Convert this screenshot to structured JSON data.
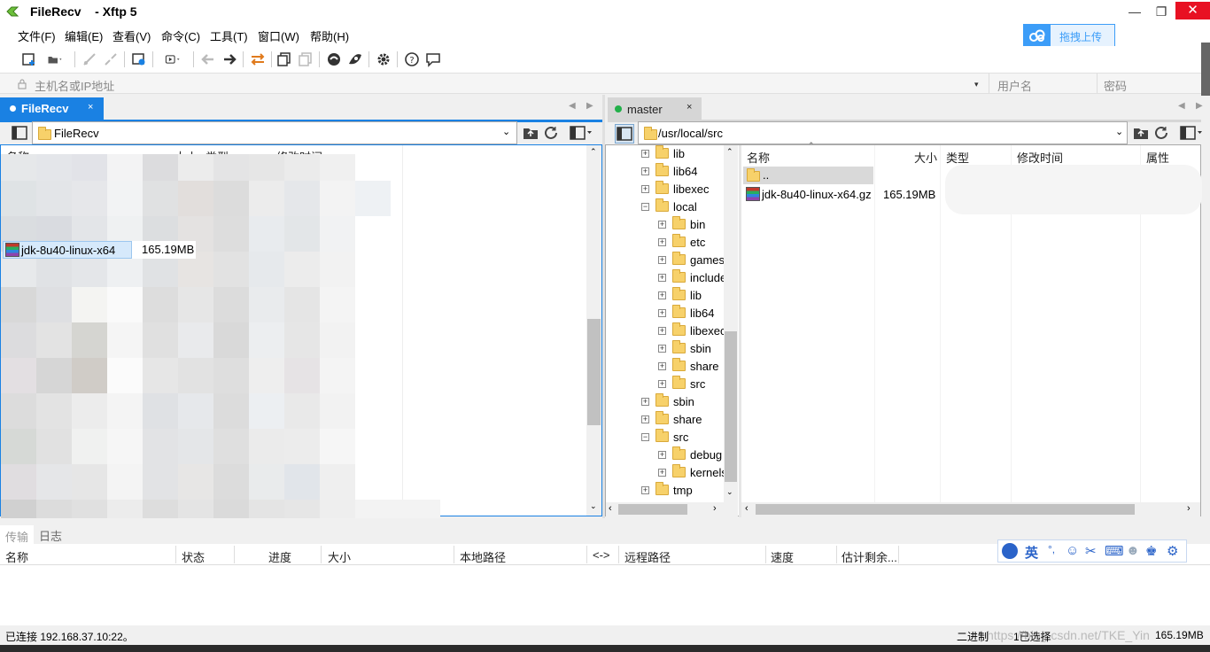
{
  "window": {
    "title": "FileRecv    - Xftp 5",
    "controls": {
      "minimize": "—",
      "restore": "❐",
      "close": "✕"
    }
  },
  "menu": [
    "文件(F)",
    "编辑(E)",
    "查看(V)",
    "命令(C)",
    "工具(T)",
    "窗口(W)",
    "帮助(H)"
  ],
  "upload_button": {
    "label": "拖拽上传",
    "accent": "#3c9df8"
  },
  "address_bar": {
    "host_placeholder": "主机名或IP地址",
    "user_placeholder": "用户名",
    "password_placeholder": "密码"
  },
  "left_panel": {
    "tab_label": "FileRecv",
    "tab_close": "×",
    "path": "FileRecv",
    "columns": [
      "名称",
      "大小",
      "类型",
      "修改时间"
    ],
    "files": [
      {
        "name": "jdk-8u40-linux-x64",
        "size": "165.19MB"
      }
    ]
  },
  "right_panel": {
    "tab_label": "master",
    "tab_close": "×",
    "status_color": "#22b04a",
    "path": "/usr/local/src",
    "tree": [
      {
        "label": "lib",
        "level": 0,
        "expand": "+"
      },
      {
        "label": "lib64",
        "level": 0,
        "expand": "+"
      },
      {
        "label": "libexec",
        "level": 0,
        "expand": "+"
      },
      {
        "label": "local",
        "level": 0,
        "expand": "-"
      },
      {
        "label": "bin",
        "level": 1,
        "expand": "+"
      },
      {
        "label": "etc",
        "level": 1,
        "expand": "+"
      },
      {
        "label": "games",
        "level": 1,
        "expand": "+"
      },
      {
        "label": "include",
        "level": 1,
        "expand": "+"
      },
      {
        "label": "lib",
        "level": 1,
        "expand": "+"
      },
      {
        "label": "lib64",
        "level": 1,
        "expand": "+"
      },
      {
        "label": "libexec",
        "level": 1,
        "expand": "+"
      },
      {
        "label": "sbin",
        "level": 1,
        "expand": "+"
      },
      {
        "label": "share",
        "level": 1,
        "expand": "+"
      },
      {
        "label": "src",
        "level": 1,
        "expand": "+"
      },
      {
        "label": "sbin",
        "level": 0,
        "expand": "+"
      },
      {
        "label": "share",
        "level": 0,
        "expand": "+"
      },
      {
        "label": "src",
        "level": 0,
        "expand": "-"
      },
      {
        "label": "debug",
        "level": 1,
        "expand": "+"
      },
      {
        "label": "kernels",
        "level": 1,
        "expand": "+"
      },
      {
        "label": "tmp",
        "level": 0,
        "expand": "+"
      }
    ],
    "columns": [
      "名称",
      "大小",
      "类型",
      "修改时间",
      "属性"
    ],
    "files": [
      {
        "name": "..",
        "size": ""
      },
      {
        "name": "jdk-8u40-linux-x64.gz",
        "size": "165.19MB"
      }
    ]
  },
  "queue": {
    "tabs": [
      "传输",
      "日志"
    ],
    "columns": [
      "名称",
      "状态",
      "进度",
      "大小",
      "本地路径",
      "<->",
      "远程路径",
      "速度",
      "估计剩余..."
    ]
  },
  "ime": {
    "lang": "英"
  },
  "status": {
    "connection": "已连接 192.168.37.10:22。",
    "mode": "二进制",
    "selected": "1已选择",
    "size": "165.19MB",
    "watermark": "https://blog.csdn.net/TKE_Yin"
  }
}
